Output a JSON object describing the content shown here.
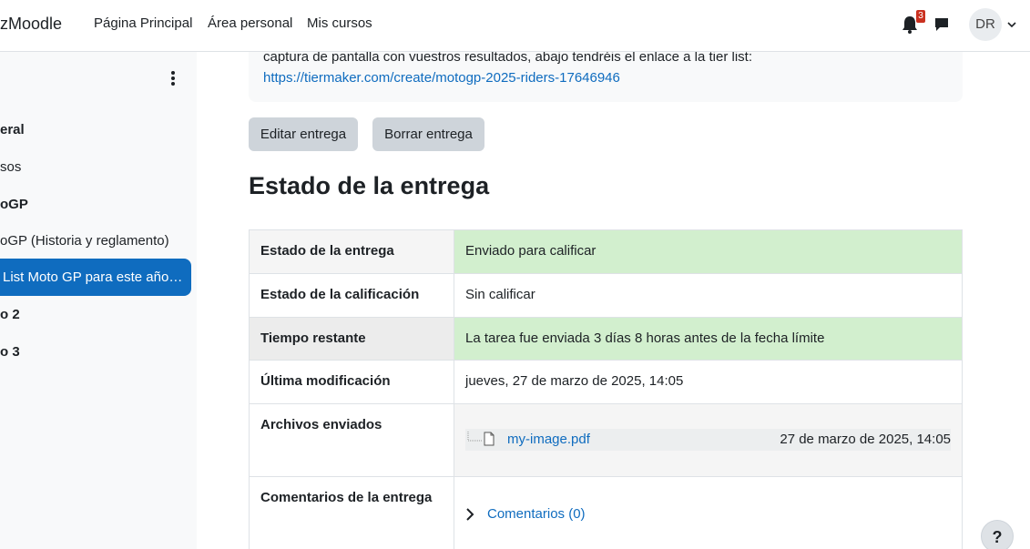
{
  "navbar": {
    "brand": "zMoodle",
    "links": [
      "Página Principal",
      "Área personal",
      "Mis cursos"
    ],
    "notifications_count": "3",
    "avatar_initials": "DR",
    "icons": {
      "notifications": "bell-icon",
      "messages": "chat-icon",
      "user_menu": "chevron-down-icon"
    }
  },
  "drawer": {
    "items": [
      {
        "label": "eral",
        "bold": true
      },
      {
        "label": "sos",
        "bold": false
      },
      {
        "label": "oGP",
        "bold": true
      },
      {
        "label": "oGP (Historia y reglamento)",
        "bold": false
      },
      {
        "label": "List Moto GP para este año…",
        "bold": false,
        "active": true
      },
      {
        "label": "o 2",
        "bold": true
      },
      {
        "label": "o 3",
        "bold": true
      }
    ]
  },
  "main": {
    "intro_text": "captura de pantalla con vuestros resultados, abajo tendréis el enlace a la tier list:",
    "intro_link": "https://tiermaker.com/create/motogp-2025-riders-17646946",
    "edit_button": "Editar entrega",
    "delete_button": "Borrar entrega",
    "section_title": "Estado de la entrega",
    "table": {
      "rows": [
        {
          "label": "Estado de la entrega",
          "value": "Enviado para calificar"
        },
        {
          "label": "Estado de la calificación",
          "value": "Sin calificar"
        },
        {
          "label": "Tiempo restante",
          "value": "La tarea fue enviada 3 días 8 horas antes de la fecha límite"
        },
        {
          "label": "Última modificación",
          "value": "jueves, 27 de marzo de 2025, 14:05"
        },
        {
          "label": "Archivos enviados",
          "file_name": "my-image.pdf",
          "file_date": "27 de marzo de 2025, 14:05"
        },
        {
          "label": "Comentarios de la entrega",
          "comments_link": "Comentarios (0)"
        }
      ]
    }
  },
  "help_button": "?",
  "colors": {
    "accent": "#0f6cbf",
    "success_bg": "#d2efce",
    "badge": "#ca3120"
  }
}
